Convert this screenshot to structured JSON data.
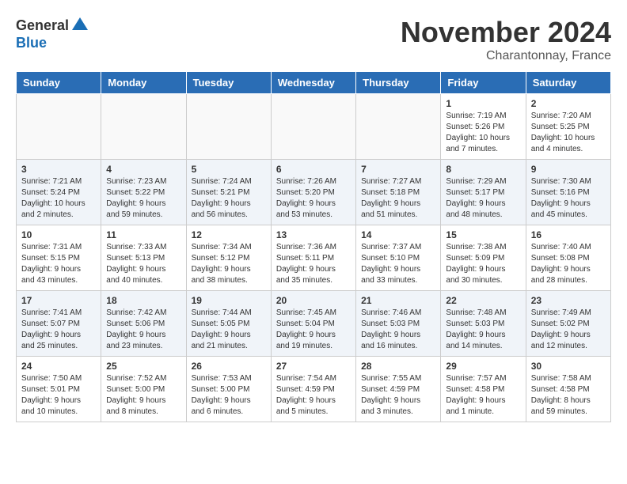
{
  "logo": {
    "general": "General",
    "blue": "Blue"
  },
  "title": "November 2024",
  "location": "Charantonnay, France",
  "days_of_week": [
    "Sunday",
    "Monday",
    "Tuesday",
    "Wednesday",
    "Thursday",
    "Friday",
    "Saturday"
  ],
  "weeks": [
    [
      {
        "day": "",
        "info": ""
      },
      {
        "day": "",
        "info": ""
      },
      {
        "day": "",
        "info": ""
      },
      {
        "day": "",
        "info": ""
      },
      {
        "day": "",
        "info": ""
      },
      {
        "day": "1",
        "info": "Sunrise: 7:19 AM\nSunset: 5:26 PM\nDaylight: 10 hours\nand 7 minutes."
      },
      {
        "day": "2",
        "info": "Sunrise: 7:20 AM\nSunset: 5:25 PM\nDaylight: 10 hours\nand 4 minutes."
      }
    ],
    [
      {
        "day": "3",
        "info": "Sunrise: 7:21 AM\nSunset: 5:24 PM\nDaylight: 10 hours\nand 2 minutes."
      },
      {
        "day": "4",
        "info": "Sunrise: 7:23 AM\nSunset: 5:22 PM\nDaylight: 9 hours\nand 59 minutes."
      },
      {
        "day": "5",
        "info": "Sunrise: 7:24 AM\nSunset: 5:21 PM\nDaylight: 9 hours\nand 56 minutes."
      },
      {
        "day": "6",
        "info": "Sunrise: 7:26 AM\nSunset: 5:20 PM\nDaylight: 9 hours\nand 53 minutes."
      },
      {
        "day": "7",
        "info": "Sunrise: 7:27 AM\nSunset: 5:18 PM\nDaylight: 9 hours\nand 51 minutes."
      },
      {
        "day": "8",
        "info": "Sunrise: 7:29 AM\nSunset: 5:17 PM\nDaylight: 9 hours\nand 48 minutes."
      },
      {
        "day": "9",
        "info": "Sunrise: 7:30 AM\nSunset: 5:16 PM\nDaylight: 9 hours\nand 45 minutes."
      }
    ],
    [
      {
        "day": "10",
        "info": "Sunrise: 7:31 AM\nSunset: 5:15 PM\nDaylight: 9 hours\nand 43 minutes."
      },
      {
        "day": "11",
        "info": "Sunrise: 7:33 AM\nSunset: 5:13 PM\nDaylight: 9 hours\nand 40 minutes."
      },
      {
        "day": "12",
        "info": "Sunrise: 7:34 AM\nSunset: 5:12 PM\nDaylight: 9 hours\nand 38 minutes."
      },
      {
        "day": "13",
        "info": "Sunrise: 7:36 AM\nSunset: 5:11 PM\nDaylight: 9 hours\nand 35 minutes."
      },
      {
        "day": "14",
        "info": "Sunrise: 7:37 AM\nSunset: 5:10 PM\nDaylight: 9 hours\nand 33 minutes."
      },
      {
        "day": "15",
        "info": "Sunrise: 7:38 AM\nSunset: 5:09 PM\nDaylight: 9 hours\nand 30 minutes."
      },
      {
        "day": "16",
        "info": "Sunrise: 7:40 AM\nSunset: 5:08 PM\nDaylight: 9 hours\nand 28 minutes."
      }
    ],
    [
      {
        "day": "17",
        "info": "Sunrise: 7:41 AM\nSunset: 5:07 PM\nDaylight: 9 hours\nand 25 minutes."
      },
      {
        "day": "18",
        "info": "Sunrise: 7:42 AM\nSunset: 5:06 PM\nDaylight: 9 hours\nand 23 minutes."
      },
      {
        "day": "19",
        "info": "Sunrise: 7:44 AM\nSunset: 5:05 PM\nDaylight: 9 hours\nand 21 minutes."
      },
      {
        "day": "20",
        "info": "Sunrise: 7:45 AM\nSunset: 5:04 PM\nDaylight: 9 hours\nand 19 minutes."
      },
      {
        "day": "21",
        "info": "Sunrise: 7:46 AM\nSunset: 5:03 PM\nDaylight: 9 hours\nand 16 minutes."
      },
      {
        "day": "22",
        "info": "Sunrise: 7:48 AM\nSunset: 5:03 PM\nDaylight: 9 hours\nand 14 minutes."
      },
      {
        "day": "23",
        "info": "Sunrise: 7:49 AM\nSunset: 5:02 PM\nDaylight: 9 hours\nand 12 minutes."
      }
    ],
    [
      {
        "day": "24",
        "info": "Sunrise: 7:50 AM\nSunset: 5:01 PM\nDaylight: 9 hours\nand 10 minutes."
      },
      {
        "day": "25",
        "info": "Sunrise: 7:52 AM\nSunset: 5:00 PM\nDaylight: 9 hours\nand 8 minutes."
      },
      {
        "day": "26",
        "info": "Sunrise: 7:53 AM\nSunset: 5:00 PM\nDaylight: 9 hours\nand 6 minutes."
      },
      {
        "day": "27",
        "info": "Sunrise: 7:54 AM\nSunset: 4:59 PM\nDaylight: 9 hours\nand 5 minutes."
      },
      {
        "day": "28",
        "info": "Sunrise: 7:55 AM\nSunset: 4:59 PM\nDaylight: 9 hours\nand 3 minutes."
      },
      {
        "day": "29",
        "info": "Sunrise: 7:57 AM\nSunset: 4:58 PM\nDaylight: 9 hours\nand 1 minute."
      },
      {
        "day": "30",
        "info": "Sunrise: 7:58 AM\nSunset: 4:58 PM\nDaylight: 8 hours\nand 59 minutes."
      }
    ]
  ]
}
